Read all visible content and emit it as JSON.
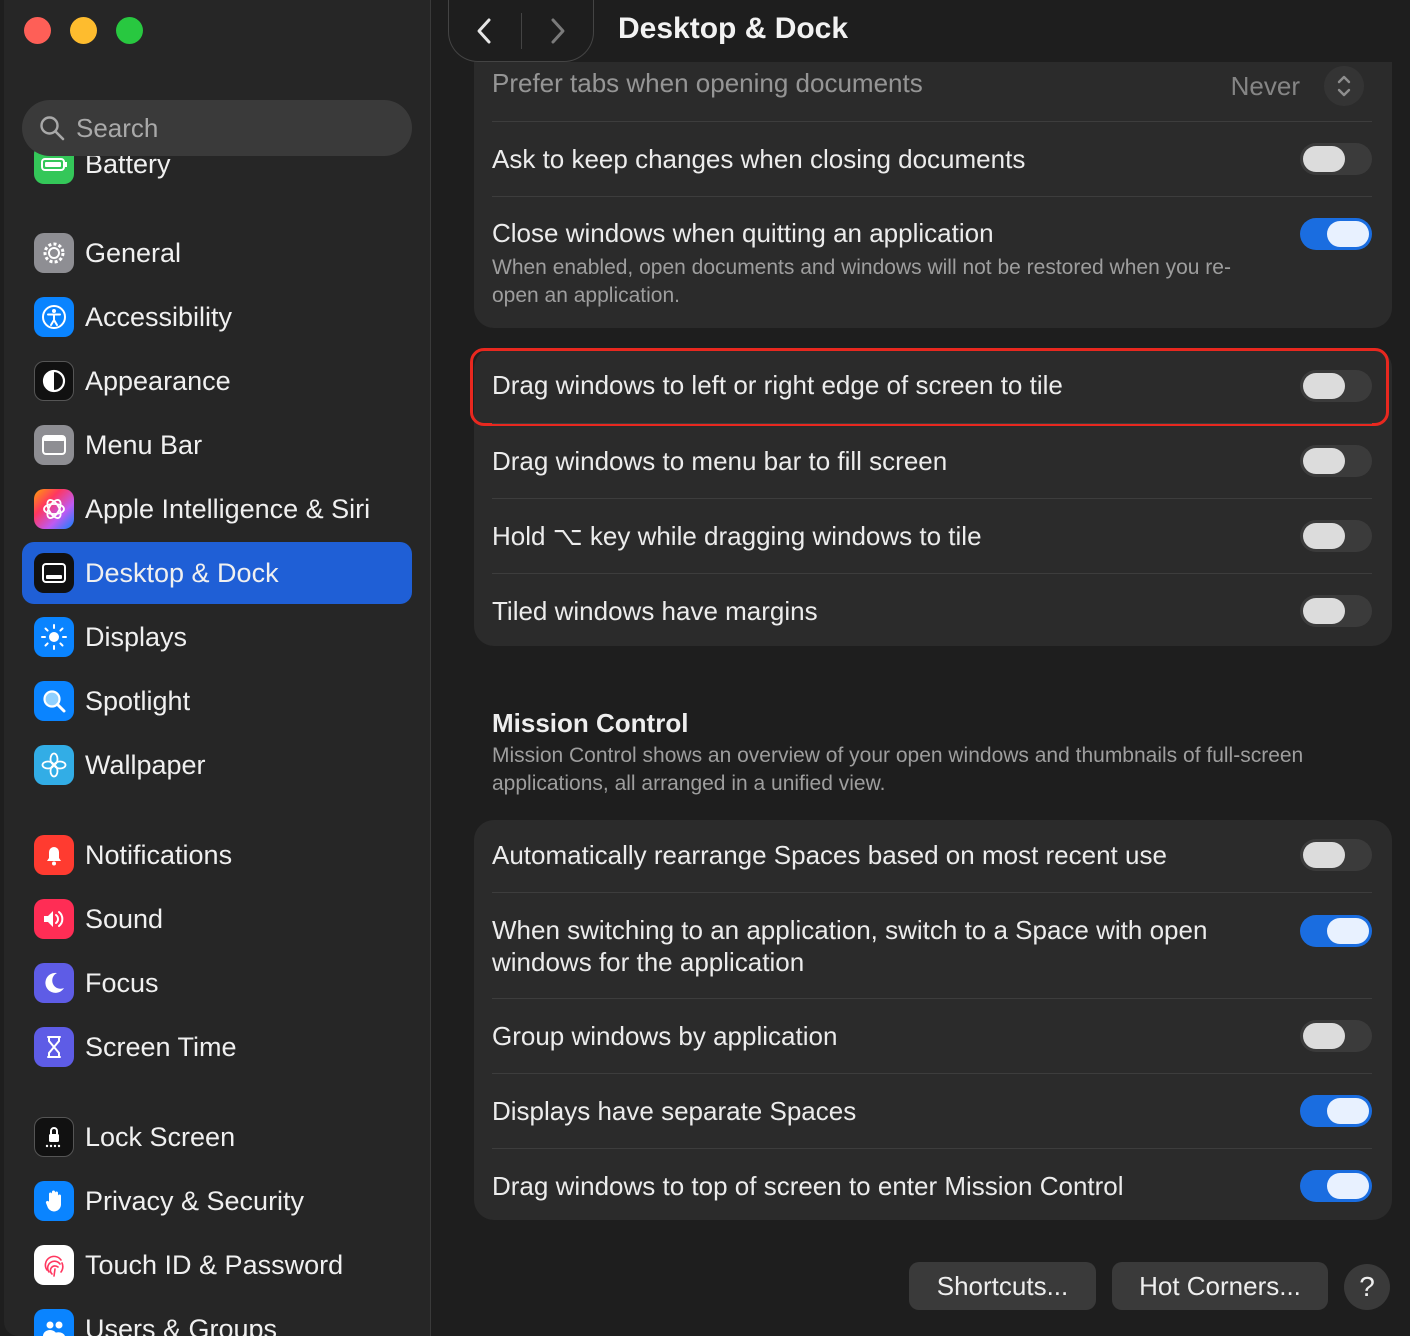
{
  "window": {
    "title": "Desktop & Dock"
  },
  "search": {
    "placeholder": "Search"
  },
  "sidebar": {
    "items": [
      {
        "label": "Battery",
        "icon": "battery-icon",
        "color": "#34c759"
      },
      {
        "label": "General",
        "icon": "gear-icon",
        "color": "#8e8e93"
      },
      {
        "label": "Accessibility",
        "icon": "accessibility-icon",
        "color": "#0a84ff"
      },
      {
        "label": "Appearance",
        "icon": "appearance-icon",
        "color": "#1c1c1e"
      },
      {
        "label": "Menu Bar",
        "icon": "menu-bar-icon",
        "color": "#8e8e93"
      },
      {
        "label": "Apple Intelligence & Siri",
        "icon": "siri-icon",
        "color": "#ff6ad5"
      },
      {
        "label": "Desktop & Dock",
        "icon": "dock-icon",
        "color": "#1c1c1e",
        "selected": true
      },
      {
        "label": "Displays",
        "icon": "displays-icon",
        "color": "#0a84ff"
      },
      {
        "label": "Spotlight",
        "icon": "spotlight-icon",
        "color": "#0a84ff"
      },
      {
        "label": "Wallpaper",
        "icon": "wallpaper-icon",
        "color": "#32ade6"
      },
      {
        "label": "Notifications",
        "icon": "bell-icon",
        "color": "#ff3b30"
      },
      {
        "label": "Sound",
        "icon": "speaker-icon",
        "color": "#ff2d55"
      },
      {
        "label": "Focus",
        "icon": "moon-icon",
        "color": "#5e5ce6"
      },
      {
        "label": "Screen Time",
        "icon": "hourglass-icon",
        "color": "#5e5ce6"
      },
      {
        "label": "Lock Screen",
        "icon": "lock-icon",
        "color": "#1c1c1e"
      },
      {
        "label": "Privacy & Security",
        "icon": "hand-icon",
        "color": "#0a84ff"
      },
      {
        "label": "Touch ID & Password",
        "icon": "fingerprint-icon",
        "color": "#ffffff"
      },
      {
        "label": "Users & Groups",
        "icon": "users-icon",
        "color": "#0a84ff"
      }
    ]
  },
  "windows_section": {
    "prefer_tabs": {
      "label": "Prefer tabs when opening documents",
      "value": "Never"
    },
    "ask_keep_changes": {
      "label": "Ask to keep changes when closing documents",
      "on": false
    },
    "close_windows": {
      "label": "Close windows when quitting an application",
      "description": "When enabled, open documents and windows will not be restored when you re-open an application.",
      "on": true
    }
  },
  "tiling_section": {
    "drag_edge": {
      "label": "Drag windows to left or right edge of screen to tile",
      "on": false
    },
    "drag_menu_bar": {
      "label": "Drag windows to menu bar to fill screen",
      "on": false
    },
    "hold_key": {
      "label": "Hold ⌥ key while dragging windows to tile",
      "on": false
    },
    "margins": {
      "label": "Tiled windows have margins",
      "on": false
    }
  },
  "mission_control": {
    "title": "Mission Control",
    "description": "Mission Control shows an overview of your open windows and thumbnails of full-screen applications, all arranged in a unified view.",
    "rearrange": {
      "label": "Automatically rearrange Spaces based on most recent use",
      "on": false
    },
    "switch_space": {
      "label": "When switching to an application, switch to a Space with open windows for the application",
      "on": true
    },
    "group_windows": {
      "label": "Group windows by application",
      "on": false
    },
    "separate_spaces": {
      "label": "Displays have separate Spaces",
      "on": true
    },
    "drag_top": {
      "label": "Drag windows to top of screen to enter Mission Control",
      "on": true
    }
  },
  "footer": {
    "shortcuts": "Shortcuts...",
    "hot_corners": "Hot Corners...",
    "help": "?"
  },
  "colors": {
    "accent": "#1f5fd6",
    "toggle_on": "#1a6de0",
    "highlight": "#e8281f"
  }
}
